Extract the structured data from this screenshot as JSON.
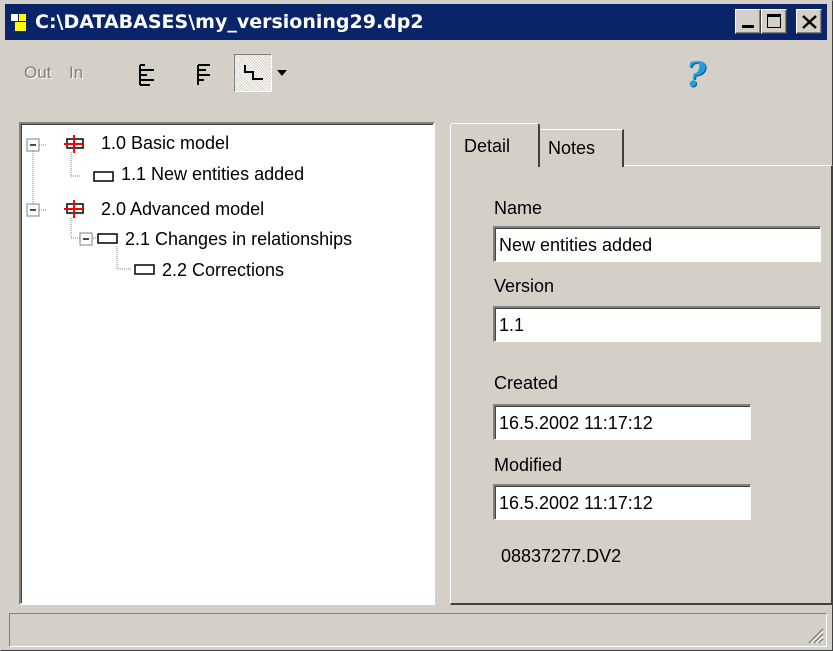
{
  "window": {
    "title": "C:\\DATABASES\\my_versioning29.dp2",
    "controls": [
      "minimize-icon",
      "maximize-icon",
      "close-icon"
    ]
  },
  "toolbar": {
    "out_label": "Out",
    "in_label": "In",
    "help_label": "?",
    "icons": [
      "outline-left-icon",
      "outline-right-icon",
      "step-layout-icon",
      "dropdown-arrow-icon",
      "help-icon"
    ]
  },
  "tree": {
    "items": [
      {
        "label": "1.0  Basic model",
        "type": "flagged-version"
      },
      {
        "label": "1.1  New entities added",
        "type": "version"
      },
      {
        "label": "2.0  Advanced model",
        "type": "flagged-version"
      },
      {
        "label": "2.1  Changes in relationships",
        "type": "version"
      },
      {
        "label": "2.2  Corrections",
        "type": "version"
      }
    ],
    "selected_index": 1
  },
  "tabs": [
    {
      "label": "Detail",
      "active": true
    },
    {
      "label": "Notes",
      "active": false
    }
  ],
  "detail": {
    "name_label": "Name",
    "name_value": "New entities added",
    "version_label": "Version",
    "version_value": "1.1",
    "created_label": "Created",
    "created_value": "16.5.2002 11:17:12",
    "modified_label": "Modified",
    "modified_value": "16.5.2002 11:17:12",
    "file_name": "08837277.DV2"
  },
  "colors": {
    "titlebar": "#0a246a",
    "face": "#d4d0c8",
    "flag": "#ff0000",
    "help": "#1ea0e0"
  }
}
